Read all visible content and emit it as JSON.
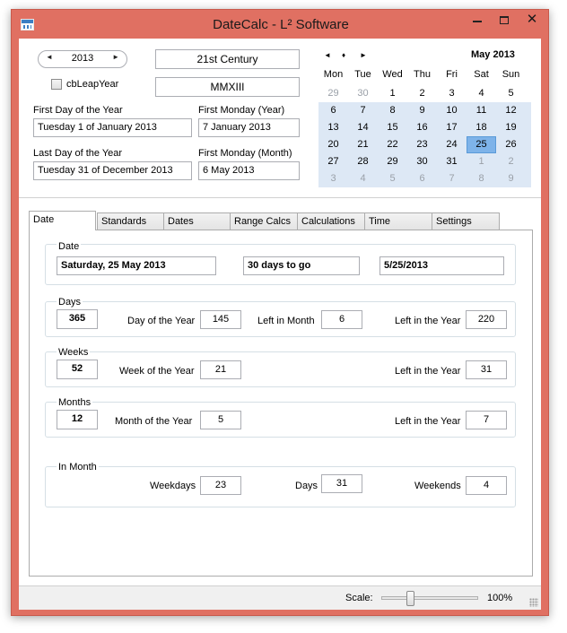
{
  "window": {
    "title": "DateCalc - L² Software",
    "close_glyph": "✕"
  },
  "top": {
    "year": "2013",
    "century": "21st Century",
    "roman": "MMXIII",
    "leap_label": "cbLeapYear",
    "first_day_year_label": "First Day of the Year",
    "first_day_year_value": "Tuesday 1 of January 2013",
    "first_monday_year_label": "First Monday (Year)",
    "first_monday_year_value": "7 January 2013",
    "last_day_year_label": "Last Day of the Year",
    "last_day_year_value": "Tuesday 31 of December 2013",
    "first_monday_month_label": "First Monday (Month)",
    "first_monday_month_value": "6 May 2013"
  },
  "calendar": {
    "title": "May 2013",
    "nav": {
      "prev": "◄",
      "today": "♦",
      "next": "►"
    },
    "dow": [
      "Mon",
      "Tue",
      "Wed",
      "Thu",
      "Fri",
      "Sat",
      "Sun"
    ],
    "weeks": [
      [
        "29",
        "30",
        "1",
        "2",
        "3",
        "4",
        "5"
      ],
      [
        "6",
        "7",
        "8",
        "9",
        "10",
        "11",
        "12"
      ],
      [
        "13",
        "14",
        "15",
        "16",
        "17",
        "18",
        "19"
      ],
      [
        "20",
        "21",
        "22",
        "23",
        "24",
        "25",
        "26"
      ],
      [
        "27",
        "28",
        "29",
        "30",
        "31",
        "1",
        "2"
      ],
      [
        "3",
        "4",
        "5",
        "6",
        "7",
        "8",
        "9"
      ]
    ],
    "selected": "25"
  },
  "tabs": [
    "Date",
    "Standards",
    "Dates",
    "Range Calcs",
    "Calculations",
    "Time",
    "Settings"
  ],
  "date_group": {
    "title": "Date",
    "long_date": "Saturday, 25 May 2013",
    "days_to_go": "30 days to go",
    "short_date": "5/25/2013"
  },
  "days_group": {
    "title": "Days",
    "total": "365",
    "day_of_year_label": "Day of the Year",
    "day_of_year": "145",
    "left_in_month_label": "Left in Month",
    "left_in_month": "6",
    "left_in_year_label": "Left in the Year",
    "left_in_year": "220"
  },
  "weeks_group": {
    "title": "Weeks",
    "total": "52",
    "week_of_year_label": "Week of the Year",
    "week_of_year": "21",
    "left_in_year_label": "Left in the Year",
    "left_in_year": "31"
  },
  "months_group": {
    "title": "Months",
    "total": "12",
    "month_of_year_label": "Month of the Year",
    "month_of_year": "5",
    "left_in_year_label": "Left in the Year",
    "left_in_year": "7"
  },
  "in_month_group": {
    "title": "In Month",
    "weekdays_label": "Weekdays",
    "weekdays": "23",
    "days_label": "Days",
    "days": "31",
    "weekends_label": "Weekends",
    "weekends": "4"
  },
  "status": {
    "scale_label": "Scale:",
    "scale_value": "100%",
    "scale_level": 0.3
  }
}
